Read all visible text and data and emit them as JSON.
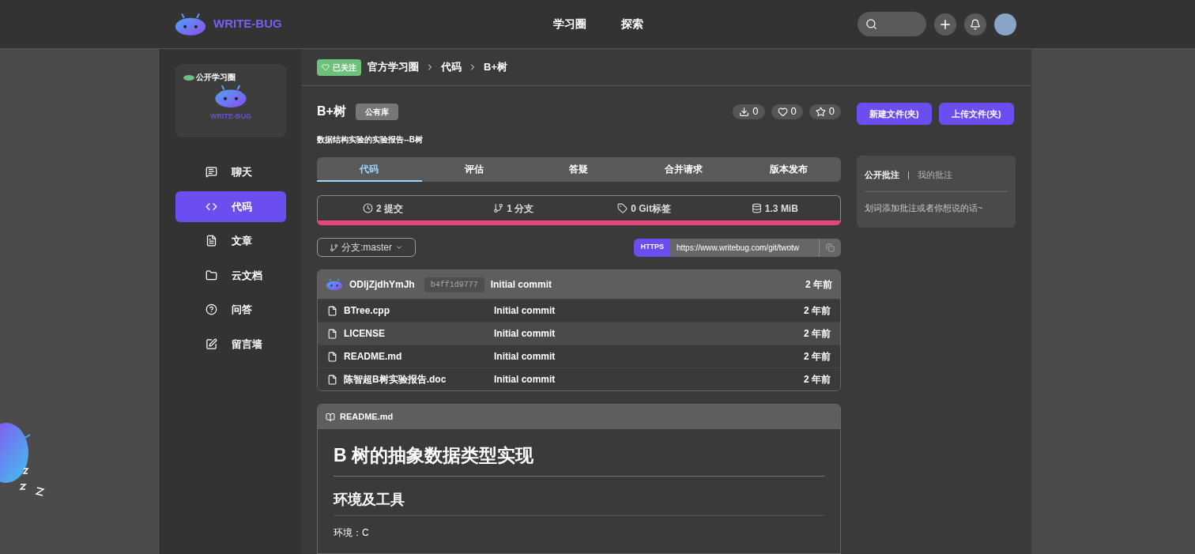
{
  "header": {
    "logo_text": "WRITE-BUG",
    "nav": [
      {
        "label": "学习圈"
      },
      {
        "label": "探索"
      }
    ]
  },
  "sidebar": {
    "card_badge": "公开学习圈",
    "card_logo_text": "WRITE-BUG",
    "items": [
      {
        "label": "聊天",
        "selected": false
      },
      {
        "label": "代码",
        "selected": true
      },
      {
        "label": "文章",
        "selected": false
      },
      {
        "label": "云文档",
        "selected": false
      },
      {
        "label": "问答",
        "selected": false
      },
      {
        "label": "留言墙",
        "selected": false
      }
    ]
  },
  "breadcrumb": {
    "follow": "已关注",
    "items": [
      "官方学习圈",
      "代码",
      "B+树"
    ]
  },
  "repo": {
    "name": "B+树",
    "badge": "公有库",
    "description": "数据结构实验的实验报告--B树",
    "counters": [
      "0",
      "0",
      "0"
    ],
    "buttons": [
      "新建文件(夹)",
      "上传文件(夹)"
    ]
  },
  "tabs": [
    {
      "label": "代码",
      "selected": true
    },
    {
      "label": "评估",
      "selected": false
    },
    {
      "label": "答疑",
      "selected": false
    },
    {
      "label": "合并请求",
      "selected": false
    },
    {
      "label": "版本发布",
      "selected": false
    }
  ],
  "stats": [
    "2 提交",
    "1 分支",
    "0 Git标签",
    "1.3 MiB"
  ],
  "branch": "分支:master",
  "clone": {
    "protocol": "HTTPS",
    "url": "https://www.writebug.com/git/twotw"
  },
  "files": {
    "latest": {
      "author": "ODljZjdhYmJh",
      "hash": "b4ff1d9777",
      "message": "Initial commit",
      "time": "2 年前"
    },
    "rows": [
      {
        "name": "BTree.cpp",
        "message": "Initial commit",
        "time": "2 年前",
        "selected": false
      },
      {
        "name": "LICENSE",
        "message": "Initial commit",
        "time": "2 年前",
        "selected": true
      },
      {
        "name": "README.md",
        "message": "Initial commit",
        "time": "2 年前",
        "selected": false
      },
      {
        "name": "陈智超B树实验报告.doc",
        "message": "Initial commit",
        "time": "2 年前",
        "selected": false
      }
    ]
  },
  "readme": {
    "title": "README.md",
    "h1": "B 树的抽象数据类型实现",
    "h2": "环境及工具",
    "lines": [
      "环境：C"
    ]
  },
  "comments": {
    "tabs": [
      {
        "label": "公开批注",
        "selected": true
      },
      {
        "label": "我的批注",
        "selected": false
      }
    ],
    "separator": "|",
    "placeholder": "划词添加批注或者你想说的话~"
  }
}
